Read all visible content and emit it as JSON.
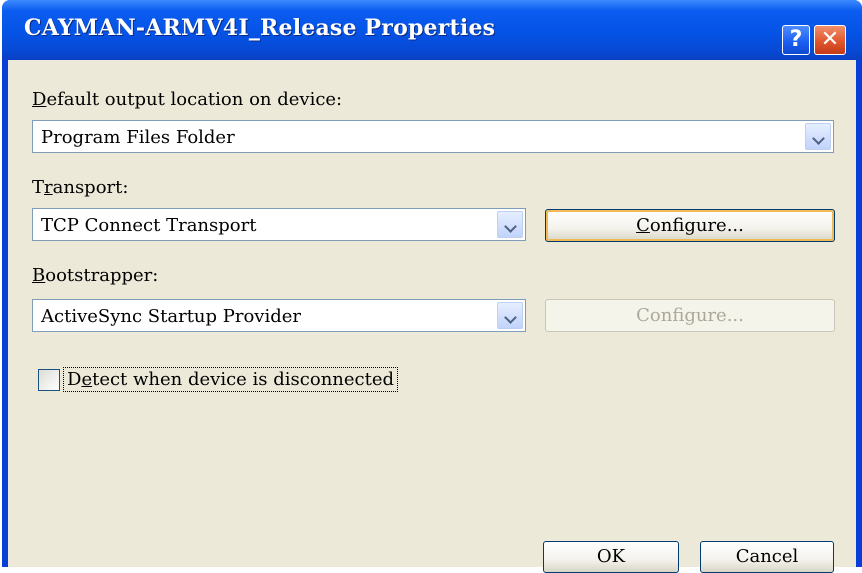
{
  "window": {
    "title": "CAYMAN-ARMV4I_Release Properties",
    "help_glyph": "?",
    "close_glyph": "✕"
  },
  "output_location": {
    "label_first": "D",
    "label_rest": "efault output location on device:",
    "value": "Program Files Folder"
  },
  "transport": {
    "label_first": "T",
    "label_mnemonic": "r",
    "label_rest": "ansport:",
    "value": "TCP Connect Transport",
    "configure_mnemonic": "C",
    "configure_rest": "onfigure..."
  },
  "bootstrapper": {
    "label_mnemonic": "B",
    "label_rest": "ootstrapper:",
    "value": "ActiveSync Startup Provider",
    "configure_label": "Configure..."
  },
  "detect": {
    "checked": false,
    "label_first": "D",
    "label_mnemonic": "e",
    "label_rest": "tect when device is disconnected"
  },
  "buttons": {
    "ok": "OK",
    "cancel": "Cancel"
  }
}
